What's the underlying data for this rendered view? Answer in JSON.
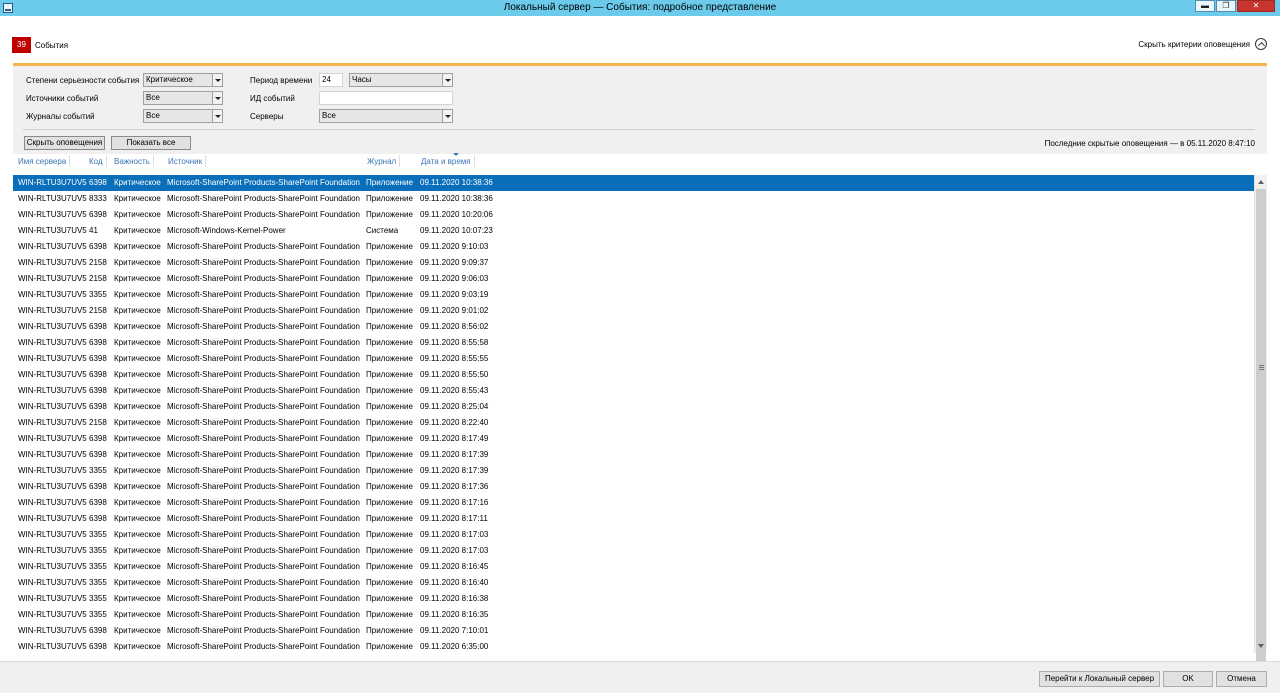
{
  "window": {
    "title": "Локальный сервер — События: подробное представление",
    "min_glyph": "▬",
    "restore_glyph": "❐",
    "close_glyph": "✕"
  },
  "events": {
    "count": "39",
    "label": "События",
    "hide_criteria": "Скрыть критерии оповещения"
  },
  "criteria": {
    "severity_label": "Степени серьезности события",
    "severity_value": "Критическое",
    "sources_label": "Источники событий",
    "sources_value": "Все",
    "logs_label": "Журналы событий",
    "logs_value": "Все",
    "period_label": "Период времени",
    "period_value": "24",
    "period_unit": "Часы",
    "event_id_label": "ИД событий",
    "event_id_value": "",
    "servers_label": "Серверы",
    "servers_value": "Все",
    "hide_alerts_btn": "Скрыть оповещения",
    "show_all_btn": "Показать все",
    "last_hidden": "Последние скрытые оповещения — в 05.11.2020 8:47:10"
  },
  "table": {
    "columns": [
      "Имя сервера",
      "Код",
      "Важность",
      "Источник",
      "Журнал",
      "Дата и время"
    ],
    "rows": [
      [
        "WIN-RLTU3U7UV5",
        "6398",
        "Критическое",
        "Microsoft-SharePoint Products-SharePoint Foundation",
        "Приложение",
        "09.11.2020 10:38:36"
      ],
      [
        "WIN-RLTU3U7UV5",
        "8333",
        "Критическое",
        "Microsoft-SharePoint Products-SharePoint Foundation",
        "Приложение",
        "09.11.2020 10:38:36"
      ],
      [
        "WIN-RLTU3U7UV5",
        "6398",
        "Критическое",
        "Microsoft-SharePoint Products-SharePoint Foundation",
        "Приложение",
        "09.11.2020 10:20:06"
      ],
      [
        "WIN-RLTU3U7UV5",
        "41",
        "Критическое",
        "Microsoft-Windows-Kernel-Power",
        "Система",
        "09.11.2020 10:07:23"
      ],
      [
        "WIN-RLTU3U7UV5",
        "6398",
        "Критическое",
        "Microsoft-SharePoint Products-SharePoint Foundation",
        "Приложение",
        "09.11.2020 9:10:03"
      ],
      [
        "WIN-RLTU3U7UV5",
        "2158",
        "Критическое",
        "Microsoft-SharePoint Products-SharePoint Foundation",
        "Приложение",
        "09.11.2020 9:09:37"
      ],
      [
        "WIN-RLTU3U7UV5",
        "2158",
        "Критическое",
        "Microsoft-SharePoint Products-SharePoint Foundation",
        "Приложение",
        "09.11.2020 9:06:03"
      ],
      [
        "WIN-RLTU3U7UV5",
        "3355",
        "Критическое",
        "Microsoft-SharePoint Products-SharePoint Foundation",
        "Приложение",
        "09.11.2020 9:03:19"
      ],
      [
        "WIN-RLTU3U7UV5",
        "2158",
        "Критическое",
        "Microsoft-SharePoint Products-SharePoint Foundation",
        "Приложение",
        "09.11.2020 9:01:02"
      ],
      [
        "WIN-RLTU3U7UV5",
        "6398",
        "Критическое",
        "Microsoft-SharePoint Products-SharePoint Foundation",
        "Приложение",
        "09.11.2020 8:56:02"
      ],
      [
        "WIN-RLTU3U7UV5",
        "6398",
        "Критическое",
        "Microsoft-SharePoint Products-SharePoint Foundation",
        "Приложение",
        "09.11.2020 8:55:58"
      ],
      [
        "WIN-RLTU3U7UV5",
        "6398",
        "Критическое",
        "Microsoft-SharePoint Products-SharePoint Foundation",
        "Приложение",
        "09.11.2020 8:55:55"
      ],
      [
        "WIN-RLTU3U7UV5",
        "6398",
        "Критическое",
        "Microsoft-SharePoint Products-SharePoint Foundation",
        "Приложение",
        "09.11.2020 8:55:50"
      ],
      [
        "WIN-RLTU3U7UV5",
        "6398",
        "Критическое",
        "Microsoft-SharePoint Products-SharePoint Foundation",
        "Приложение",
        "09.11.2020 8:55:43"
      ],
      [
        "WIN-RLTU3U7UV5",
        "6398",
        "Критическое",
        "Microsoft-SharePoint Products-SharePoint Foundation",
        "Приложение",
        "09.11.2020 8:25:04"
      ],
      [
        "WIN-RLTU3U7UV5",
        "2158",
        "Критическое",
        "Microsoft-SharePoint Products-SharePoint Foundation",
        "Приложение",
        "09.11.2020 8:22:40"
      ],
      [
        "WIN-RLTU3U7UV5",
        "6398",
        "Критическое",
        "Microsoft-SharePoint Products-SharePoint Foundation",
        "Приложение",
        "09.11.2020 8:17:49"
      ],
      [
        "WIN-RLTU3U7UV5",
        "6398",
        "Критическое",
        "Microsoft-SharePoint Products-SharePoint Foundation",
        "Приложение",
        "09.11.2020 8:17:39"
      ],
      [
        "WIN-RLTU3U7UV5",
        "3355",
        "Критическое",
        "Microsoft-SharePoint Products-SharePoint Foundation",
        "Приложение",
        "09.11.2020 8:17:39"
      ],
      [
        "WIN-RLTU3U7UV5",
        "6398",
        "Критическое",
        "Microsoft-SharePoint Products-SharePoint Foundation",
        "Приложение",
        "09.11.2020 8:17:36"
      ],
      [
        "WIN-RLTU3U7UV5",
        "6398",
        "Критическое",
        "Microsoft-SharePoint Products-SharePoint Foundation",
        "Приложение",
        "09.11.2020 8:17:16"
      ],
      [
        "WIN-RLTU3U7UV5",
        "6398",
        "Критическое",
        "Microsoft-SharePoint Products-SharePoint Foundation",
        "Приложение",
        "09.11.2020 8:17:11"
      ],
      [
        "WIN-RLTU3U7UV5",
        "3355",
        "Критическое",
        "Microsoft-SharePoint Products-SharePoint Foundation",
        "Приложение",
        "09.11.2020 8:17:03"
      ],
      [
        "WIN-RLTU3U7UV5",
        "3355",
        "Критическое",
        "Microsoft-SharePoint Products-SharePoint Foundation",
        "Приложение",
        "09.11.2020 8:17:03"
      ],
      [
        "WIN-RLTU3U7UV5",
        "3355",
        "Критическое",
        "Microsoft-SharePoint Products-SharePoint Foundation",
        "Приложение",
        "09.11.2020 8:16:45"
      ],
      [
        "WIN-RLTU3U7UV5",
        "3355",
        "Критическое",
        "Microsoft-SharePoint Products-SharePoint Foundation",
        "Приложение",
        "09.11.2020 8:16:40"
      ],
      [
        "WIN-RLTU3U7UV5",
        "3355",
        "Критическое",
        "Microsoft-SharePoint Products-SharePoint Foundation",
        "Приложение",
        "09.11.2020 8:16:38"
      ],
      [
        "WIN-RLTU3U7UV5",
        "3355",
        "Критическое",
        "Microsoft-SharePoint Products-SharePoint Foundation",
        "Приложение",
        "09.11.2020 8:16:35"
      ],
      [
        "WIN-RLTU3U7UV5",
        "6398",
        "Критическое",
        "Microsoft-SharePoint Products-SharePoint Foundation",
        "Приложение",
        "09.11.2020 7:10:01"
      ],
      [
        "WIN-RLTU3U7UV5",
        "6398",
        "Критическое",
        "Microsoft-SharePoint Products-SharePoint Foundation",
        "Приложение",
        "09.11.2020 6:35:00"
      ]
    ],
    "selected_row": 0
  },
  "footer": {
    "goto_btn": "Перейти к Локальный сервер",
    "ok_btn": "OK",
    "cancel_btn": "Отмена"
  },
  "colors": {
    "titlebar": "#6ccbeb",
    "selection": "#0a6fba",
    "badge": "#c00000",
    "accent_bar": "#f5b552",
    "header_text": "#3a75b5"
  }
}
